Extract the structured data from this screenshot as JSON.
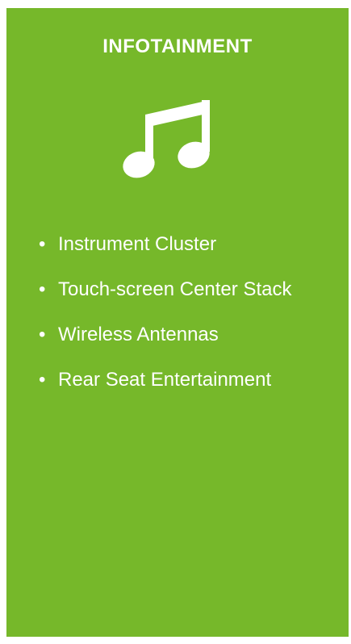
{
  "card": {
    "title": "INFOTAINMENT",
    "icon": "music-note-icon",
    "background_color": "#76b82a",
    "text_color": "#ffffff",
    "items": [
      {
        "bullet": "•",
        "label": "Instrument Cluster"
      },
      {
        "bullet": "•",
        "label": "Touch-screen Center Stack"
      },
      {
        "bullet": "•",
        "label": "Wireless Antennas"
      },
      {
        "bullet": "•",
        "label": "Rear Seat Entertainment"
      }
    ]
  }
}
